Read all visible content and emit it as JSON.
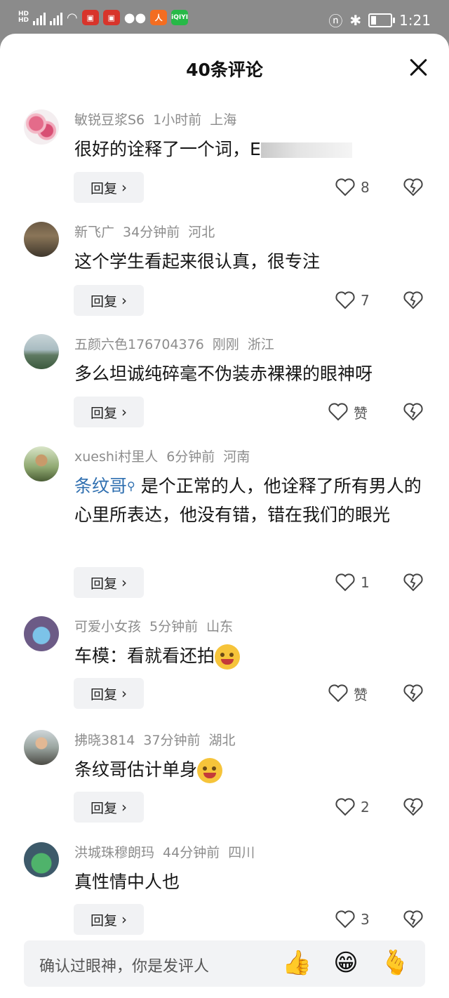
{
  "status_bar": {
    "left_icons": [
      "hd-icon",
      "signal-4g-icon",
      "signal-4g-icon",
      "wifi-icon",
      "app-icon-red",
      "app-icon-red",
      "wechat-icon",
      "app-icon-orange",
      "iqiyi-icon"
    ],
    "time": "1:21",
    "right_icons": [
      "nfc-icon",
      "bluetooth-icon",
      "battery-icon"
    ]
  },
  "header": {
    "title": "40条评论"
  },
  "comments": [
    {
      "username": "敏锐豆浆S6",
      "time": "1小时前",
      "location": "上海",
      "text": "很好的诠释了一个词，E",
      "likes": "8",
      "reply_label": "回复"
    },
    {
      "username": "新飞广",
      "time": "34分钟前",
      "location": "河北",
      "text": "这个学生看起来很认真，很专注",
      "likes": "7",
      "reply_label": "回复"
    },
    {
      "username": "五颜六色176704376",
      "time": "刚刚",
      "location": "浙江",
      "text": "多么坦诚纯碎毫不伪装赤裸裸的眼神呀",
      "likes": "赞",
      "reply_label": "回复"
    },
    {
      "username": "xueshi村里人",
      "time": "6分钟前",
      "location": "河南",
      "mention": "条纹哥",
      "text": "是个正常的人，他诠释了所有男人的心里所表达，他没有错，错在我们的眼光",
      "likes": "1",
      "reply_label": "回复"
    },
    {
      "username": "可爱小女孩",
      "time": "5分钟前",
      "location": "山东",
      "text": "车模：看就看还拍",
      "likes": "赞",
      "reply_label": "回复"
    },
    {
      "username": "拂晓3814",
      "time": "37分钟前",
      "location": "湖北",
      "text": "条纹哥估计单身",
      "likes": "2",
      "reply_label": "回复"
    },
    {
      "username": "洪城珠穆朗玛",
      "time": "44分钟前",
      "location": "四川",
      "text": "真性情中人也",
      "likes": "3",
      "reply_label": "回复"
    }
  ],
  "input": {
    "placeholder": "确认过眼神，你是发评人"
  },
  "quick_emojis": [
    "thumbs-up-icon",
    "grin-icon",
    "heart-hand-icon"
  ],
  "colors": {
    "mention": "#2f6fb0",
    "background": "#ffffff",
    "reply_bg": "#f1f2f4"
  }
}
